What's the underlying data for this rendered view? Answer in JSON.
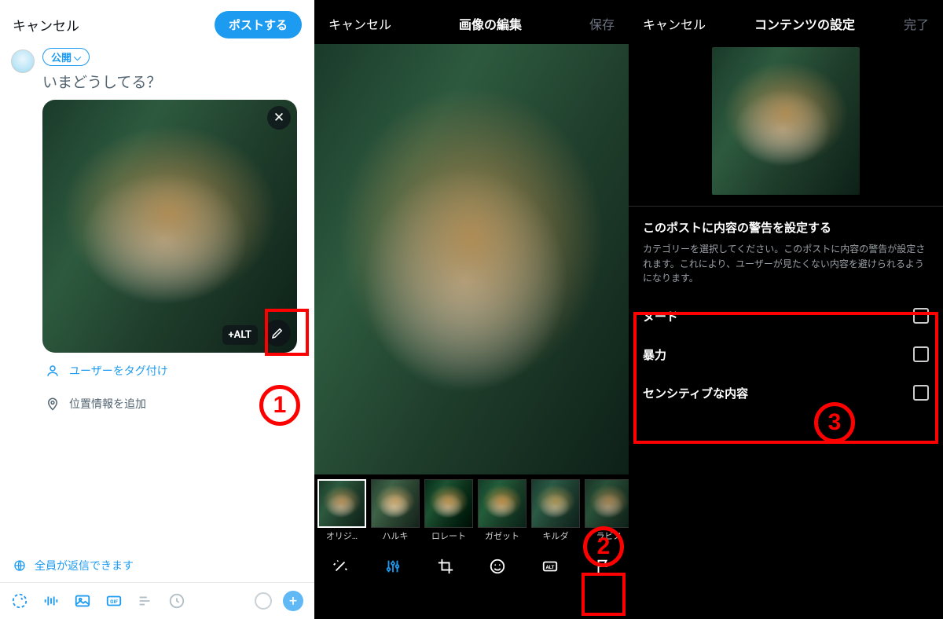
{
  "panel1": {
    "cancel": "キャンセル",
    "post": "ポストする",
    "audience": "公開",
    "placeholder": "いまどうしてる？",
    "alt_badge": "+ALT",
    "tag_users": "ユーザーをタグ付け",
    "add_location": "位置情報を追加",
    "reply_note": "全員が返信できます"
  },
  "panel2": {
    "cancel": "キャンセル",
    "title": "画像の編集",
    "save": "保存",
    "filters": [
      {
        "label": "オリジ…"
      },
      {
        "label": "ハルキ"
      },
      {
        "label": "ロレート"
      },
      {
        "label": "ガゼット"
      },
      {
        "label": "キルダ"
      },
      {
        "label": "ラビス"
      }
    ],
    "tools": [
      "enhance",
      "adjust",
      "crop",
      "emoji",
      "alt",
      "flag"
    ]
  },
  "panel3": {
    "cancel": "キャンセル",
    "title": "コンテンツの設定",
    "done": "完了",
    "heading": "このポストに内容の警告を設定する",
    "description": "カテゴリーを選択してください。このポストに内容の警告が設定されます。これにより、ユーザーが見たくない内容を避けられるようになります。",
    "options": [
      {
        "label": "ヌード"
      },
      {
        "label": "暴力"
      },
      {
        "label": "センシティブな内容"
      }
    ]
  },
  "annotations": {
    "n1": "1",
    "n2": "2",
    "n3": "3"
  }
}
